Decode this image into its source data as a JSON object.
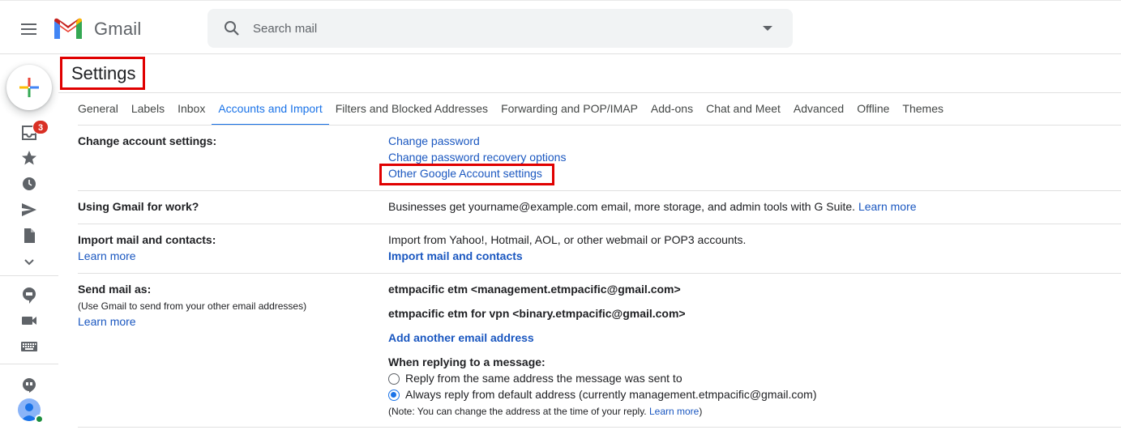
{
  "app": {
    "name": "Gmail",
    "brand_colors": {
      "red": "#ea4335",
      "blue": "#4285f4",
      "green": "#34a853",
      "yellow": "#fbbc04"
    }
  },
  "search": {
    "placeholder": "Search mail"
  },
  "left_rail": {
    "inbox_badge": "3",
    "icons": [
      "inbox-icon",
      "star-icon",
      "clock-icon",
      "send-icon",
      "draft-icon",
      "chevron-down-icon",
      "chat-icon",
      "video-icon",
      "keyboard-icon",
      "hangouts-icon",
      "avatar"
    ]
  },
  "page": {
    "title": "Settings"
  },
  "tabs": [
    {
      "label": "General",
      "active": false
    },
    {
      "label": "Labels",
      "active": false
    },
    {
      "label": "Inbox",
      "active": false
    },
    {
      "label": "Accounts and Import",
      "active": true
    },
    {
      "label": "Filters and Blocked Addresses",
      "active": false
    },
    {
      "label": "Forwarding and POP/IMAP",
      "active": false
    },
    {
      "label": "Add-ons",
      "active": false
    },
    {
      "label": "Chat and Meet",
      "active": false
    },
    {
      "label": "Advanced",
      "active": false
    },
    {
      "label": "Offline",
      "active": false
    },
    {
      "label": "Themes",
      "active": false
    }
  ],
  "sections": {
    "change_account": {
      "label": "Change account settings:",
      "links": [
        "Change password",
        "Change password recovery options",
        "Other Google Account settings"
      ]
    },
    "work": {
      "label": "Using Gmail for work?",
      "text": "Businesses get yourname@example.com email, more storage, and admin tools with G Suite.",
      "link": "Learn more"
    },
    "import": {
      "label": "Import mail and contacts:",
      "learn_more": "Learn more",
      "text": "Import from Yahoo!, Hotmail, AOL, or other webmail or POP3 accounts.",
      "action": "Import mail and contacts"
    },
    "send_as": {
      "label": "Send mail as:",
      "sublabel": "(Use Gmail to send from your other email addresses)",
      "learn_more": "Learn more",
      "addresses": [
        "etmpacific etm <management.etmpacific@gmail.com>",
        "etmpacific etm for vpn <binary.etmpacific@gmail.com>"
      ],
      "add_address": "Add another email address",
      "reply_heading": "When replying to a message:",
      "reply_options": [
        {
          "label": "Reply from the same address the message was sent to",
          "checked": false
        },
        {
          "label": "Always reply from default address (currently management.etmpacific@gmail.com)",
          "checked": true
        }
      ],
      "note": "(Note: You can change the address at the time of your reply.",
      "note_link": "Learn more",
      "note_end": ")"
    }
  }
}
